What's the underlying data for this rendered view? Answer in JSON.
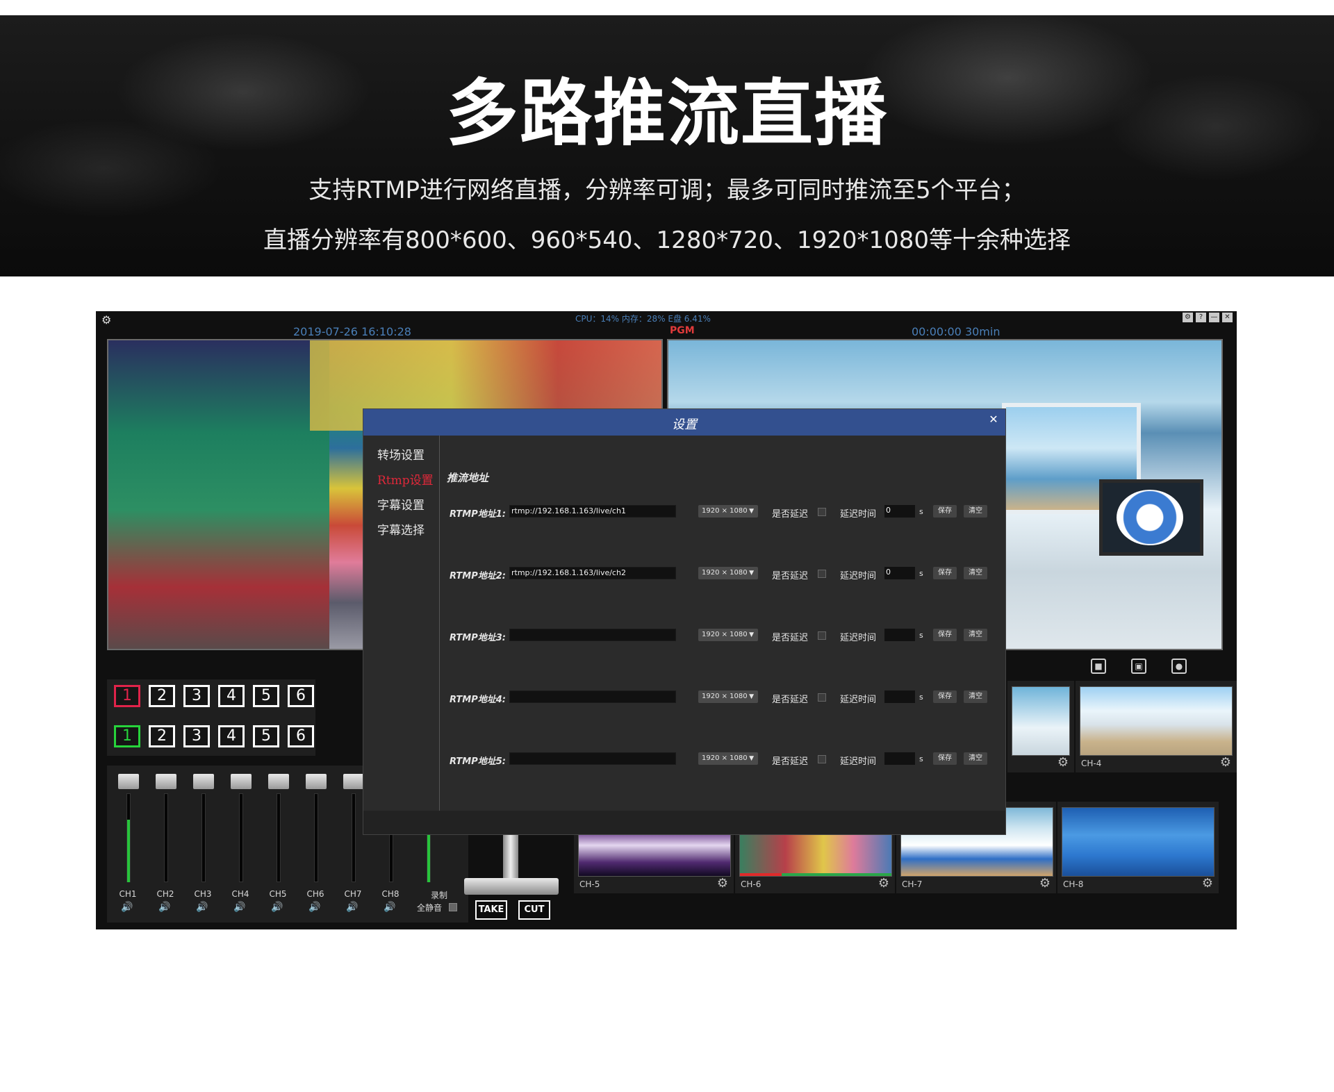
{
  "banner": {
    "title": "多路推流直播",
    "line1": "支持RTMP进行网络直播，分辨率可调；最多可同时推流至5个平台；",
    "line2": "直播分辨率有800*600、960*540、1280*720、1920*1080等十余种选择"
  },
  "app": {
    "sysinfo": "CPU：14%  内存：28%  E盘 6.41%",
    "datetime": "2019-07-26  16:10:28",
    "pgm_label": "PGM",
    "timer": "00:00:00  30min",
    "window_buttons": [
      "⚙",
      "?",
      "—",
      "✕"
    ],
    "app_icon": "⚙",
    "preview_row": [
      "1",
      "2",
      "3",
      "4",
      "5",
      "6"
    ],
    "program_row": [
      "1",
      "2",
      "3",
      "4",
      "5",
      "6"
    ],
    "mixer": {
      "channels": [
        "CH1",
        "CH2",
        "CH3",
        "CH4",
        "CH5",
        "CH6",
        "CH7",
        "CH8"
      ],
      "speaker_glyph": "🔊",
      "record_label": "录制",
      "mute_all_label": "全静音"
    },
    "take_label": "TAKE",
    "cut_label": "CUT",
    "thumbnails": [
      {
        "label": "CH-4"
      },
      {
        "label": "CH-5"
      },
      {
        "label": "CH-6"
      },
      {
        "label": "CH-7"
      },
      {
        "label": "CH-8"
      }
    ],
    "gear_glyph": "⚙",
    "monitor_tools": [
      "■",
      "▣",
      "●"
    ]
  },
  "dialog": {
    "title": "设置",
    "close": "✕",
    "nav": [
      "转场设置",
      "Rtmp设置",
      "字幕设置",
      "字幕选择"
    ],
    "active_nav": 1,
    "section_title": "推流地址",
    "rows": [
      {
        "label": "RTMP地址1:",
        "url": "rtmp://192.168.1.163/live/ch1",
        "resolution": "1920 × 1080",
        "delay_q": "是否延迟",
        "delay_time_label": "延迟时间",
        "delay": "0",
        "unit": "s",
        "save": "保存",
        "clear": "清空"
      },
      {
        "label": "RTMP地址2:",
        "url": "rtmp://192.168.1.163/live/ch2",
        "resolution": "1920 × 1080",
        "delay_q": "是否延迟",
        "delay_time_label": "延迟时间",
        "delay": "0",
        "unit": "s",
        "save": "保存",
        "clear": "清空"
      },
      {
        "label": "RTMP地址3:",
        "url": "",
        "resolution": "1920 × 1080",
        "delay_q": "是否延迟",
        "delay_time_label": "延迟时间",
        "delay": "",
        "unit": "s",
        "save": "保存",
        "clear": "清空"
      },
      {
        "label": "RTMP地址4:",
        "url": "",
        "resolution": "1920 × 1080",
        "delay_q": "是否延迟",
        "delay_time_label": "延迟时间",
        "delay": "",
        "unit": "s",
        "save": "保存",
        "clear": "清空"
      },
      {
        "label": "RTMP地址5:",
        "url": "",
        "resolution": "1920 × 1080",
        "delay_q": "是否延迟",
        "delay_time_label": "延迟时间",
        "delay": "",
        "unit": "s",
        "save": "保存",
        "clear": "清空"
      }
    ]
  }
}
